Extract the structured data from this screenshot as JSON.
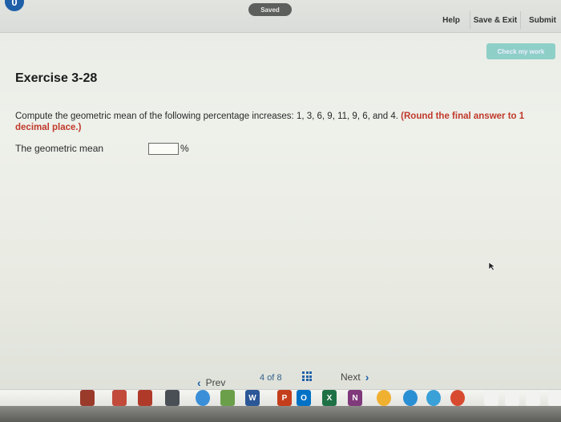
{
  "header": {
    "logo_text": "0",
    "saved_label": "Saved",
    "help_label": "Help",
    "save_exit_label": "Save & Exit",
    "submit_label": "Submit",
    "check_label": "Check my work"
  },
  "exercise": {
    "title": "Exercise 3-28",
    "question": "Compute the geometric mean of the following percentage increases: 1, 3, 6, 9, 11, 9, 6, and 4.",
    "instruction": "(Round the final answer to 1 decimal place.)",
    "answer_label": "The geometric mean",
    "answer_value": "",
    "answer_unit": "%"
  },
  "nav": {
    "prev_label": "Prev",
    "page_current": "4",
    "page_of": "of",
    "page_total": "8",
    "next_label": "Next"
  },
  "dock": {
    "apps": [
      {
        "name": "word-icon",
        "letter": "W",
        "color": "#2b5797"
      },
      {
        "name": "powerpoint-icon",
        "letter": "P",
        "color": "#c43e1c"
      },
      {
        "name": "outlook-icon",
        "letter": "O",
        "color": "#0072c6"
      },
      {
        "name": "excel-icon",
        "letter": "X",
        "color": "#1e7145"
      },
      {
        "name": "onenote-icon",
        "letter": "N",
        "color": "#80397b"
      }
    ]
  },
  "colors": {
    "accent_blue": "#1f5fa8",
    "instruction_red": "#c0392b",
    "check_button": "#8ecfc7"
  }
}
